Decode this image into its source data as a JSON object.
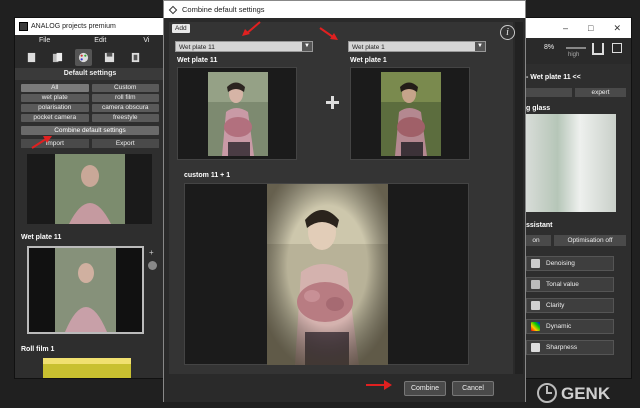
{
  "left_app": {
    "title": "ANALOG projects premium",
    "menu": [
      "File",
      "Edit",
      "Vi"
    ],
    "toolbar_icons": [
      "page-icon",
      "pages-icon",
      "palette-icon",
      "save-icon",
      "film-icon"
    ],
    "section_title": "Default settings",
    "presets": [
      "All",
      "Custom",
      "wet plate",
      "roll film",
      "polarisation",
      "camera obscura",
      "pocket camera",
      "freestyle"
    ],
    "combine_label": "Combine default settings",
    "import_label": "Import",
    "export_label": "Export",
    "thumb_label_1": "Wet plate 11",
    "thumb_label_2": "Roll film 1"
  },
  "right_app": {
    "window_controls": [
      "–",
      "□",
      "✕"
    ],
    "zoom": "8%",
    "zoom_label": "high",
    "panel_title": "- Wet plate 11 <<",
    "tab_expert": "expert",
    "glass_label": "g glass",
    "assistant_label": "ssistant",
    "assist_on": "on",
    "optimisation_off": "Optimisation off",
    "adjustments": [
      {
        "label": "Denoising",
        "icon": "denoising-icon",
        "color": "#cccccc"
      },
      {
        "label": "Tonal value",
        "icon": "tonal-value-icon",
        "color": "#bbbbbb"
      },
      {
        "label": "Clarity",
        "icon": "clarity-icon",
        "color": "#d0d0d0"
      },
      {
        "label": "Dynamic",
        "icon": "dynamic-icon",
        "color": "#ffcc00"
      },
      {
        "label": "Sharpness",
        "icon": "sharpness-icon",
        "color": "#dddddd"
      }
    ]
  },
  "dialog": {
    "title": "Combine default settings",
    "add_label": "Add",
    "left_dropdown": "Wet plate 11",
    "right_dropdown": "Wet plate 1",
    "left_label": "Wet plate 11",
    "right_label": "Wet plate 1",
    "result_label": "custom 11 + 1",
    "info_label": "i",
    "combine_label": "Combine",
    "cancel_label": "Cancel"
  },
  "colors": {
    "annotation_arrow": "#e02020",
    "dialog_bg": "#2a2a2a",
    "panel_bg": "#343434"
  },
  "watermark": "GENK"
}
